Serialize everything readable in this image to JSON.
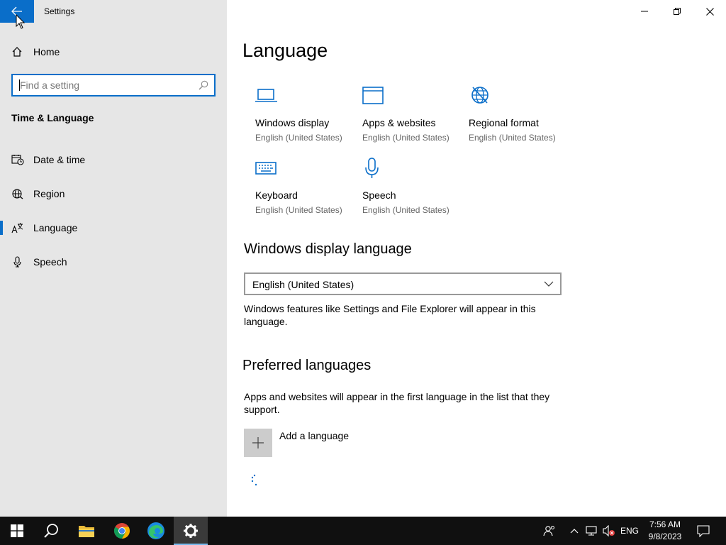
{
  "window": {
    "title": "Settings"
  },
  "sidebar": {
    "home_label": "Home",
    "search_placeholder": "Find a setting",
    "section_title": "Time & Language",
    "items": [
      {
        "label": "Date & time",
        "icon": "date-time-icon"
      },
      {
        "label": "Region",
        "icon": "region-globe-icon"
      },
      {
        "label": "Language",
        "icon": "language-icon",
        "selected": true
      },
      {
        "label": "Speech",
        "icon": "microphone-icon"
      }
    ]
  },
  "main": {
    "title": "Language",
    "tiles": [
      {
        "name": "Windows display",
        "sub": "English (United States)",
        "icon": "monitor-icon"
      },
      {
        "name": "Apps & websites",
        "sub": "English (United States)",
        "icon": "browser-window-icon"
      },
      {
        "name": "Regional format",
        "sub": "English (United States)",
        "icon": "globe-format-icon"
      },
      {
        "name": "Keyboard",
        "sub": "English (United States)",
        "icon": "keyboard-icon"
      },
      {
        "name": "Speech",
        "sub": "English (United States)",
        "icon": "microphone-icon"
      }
    ],
    "display_language": {
      "heading": "Windows display language",
      "selected": "English (United States)",
      "description": "Windows features like Settings and File Explorer will appear in this language."
    },
    "preferred": {
      "heading": "Preferred languages",
      "description": "Apps and websites will appear in the first language in the list that they support.",
      "add_label": "Add a language"
    }
  },
  "taskbar": {
    "apps": [
      "start-icon",
      "search-icon",
      "file-explorer-icon",
      "chrome-icon",
      "edge-icon",
      "settings-gear-icon"
    ],
    "language": "ENG",
    "time": "7:56 AM",
    "date": "9/8/2023"
  },
  "colors": {
    "accent": "#0a6ec9",
    "sidebar_bg": "#e6e6e6",
    "taskbar_bg": "#101010"
  }
}
